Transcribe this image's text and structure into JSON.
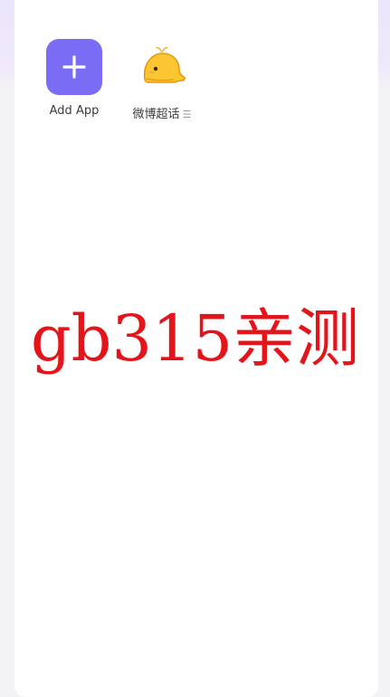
{
  "apps": [
    {
      "label": "Add App",
      "icon": "plus-icon",
      "color": "#7b6cf6"
    },
    {
      "label": "微博超话",
      "icon": "whale-icon",
      "menu": "☰"
    }
  ],
  "watermark": {
    "text": "gb315亲测",
    "color": "#e3151b"
  }
}
